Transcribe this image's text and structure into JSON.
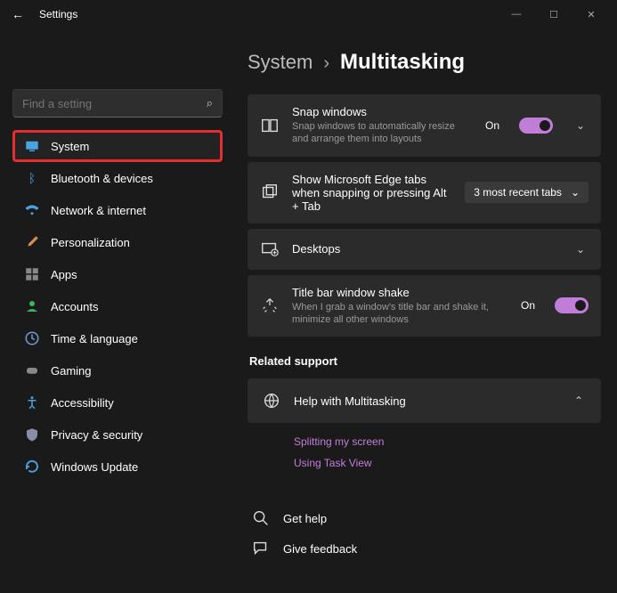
{
  "window": {
    "title": "Settings"
  },
  "search": {
    "placeholder": "Find a setting"
  },
  "sidebar": {
    "items": [
      {
        "label": "System"
      },
      {
        "label": "Bluetooth & devices"
      },
      {
        "label": "Network & internet"
      },
      {
        "label": "Personalization"
      },
      {
        "label": "Apps"
      },
      {
        "label": "Accounts"
      },
      {
        "label": "Time & language"
      },
      {
        "label": "Gaming"
      },
      {
        "label": "Accessibility"
      },
      {
        "label": "Privacy & security"
      },
      {
        "label": "Windows Update"
      }
    ]
  },
  "breadcrumb": {
    "parent": "System",
    "sep": "›",
    "current": "Multitasking"
  },
  "cards": {
    "snap": {
      "title": "Snap windows",
      "sub": "Snap windows to automatically resize and arrange them into layouts",
      "status": "On"
    },
    "edge": {
      "title": "Show Microsoft Edge tabs when snapping or pressing Alt + Tab",
      "dropdown": "3 most recent tabs"
    },
    "desktops": {
      "title": "Desktops"
    },
    "shake": {
      "title": "Title bar window shake",
      "sub": "When I grab a window's title bar and shake it, minimize all other windows",
      "status": "On"
    }
  },
  "relatedSupport": {
    "heading": "Related support",
    "help": "Help with Multitasking",
    "links": [
      "Splitting my screen",
      "Using Task View"
    ]
  },
  "footer": {
    "getHelp": "Get help",
    "feedback": "Give feedback"
  }
}
